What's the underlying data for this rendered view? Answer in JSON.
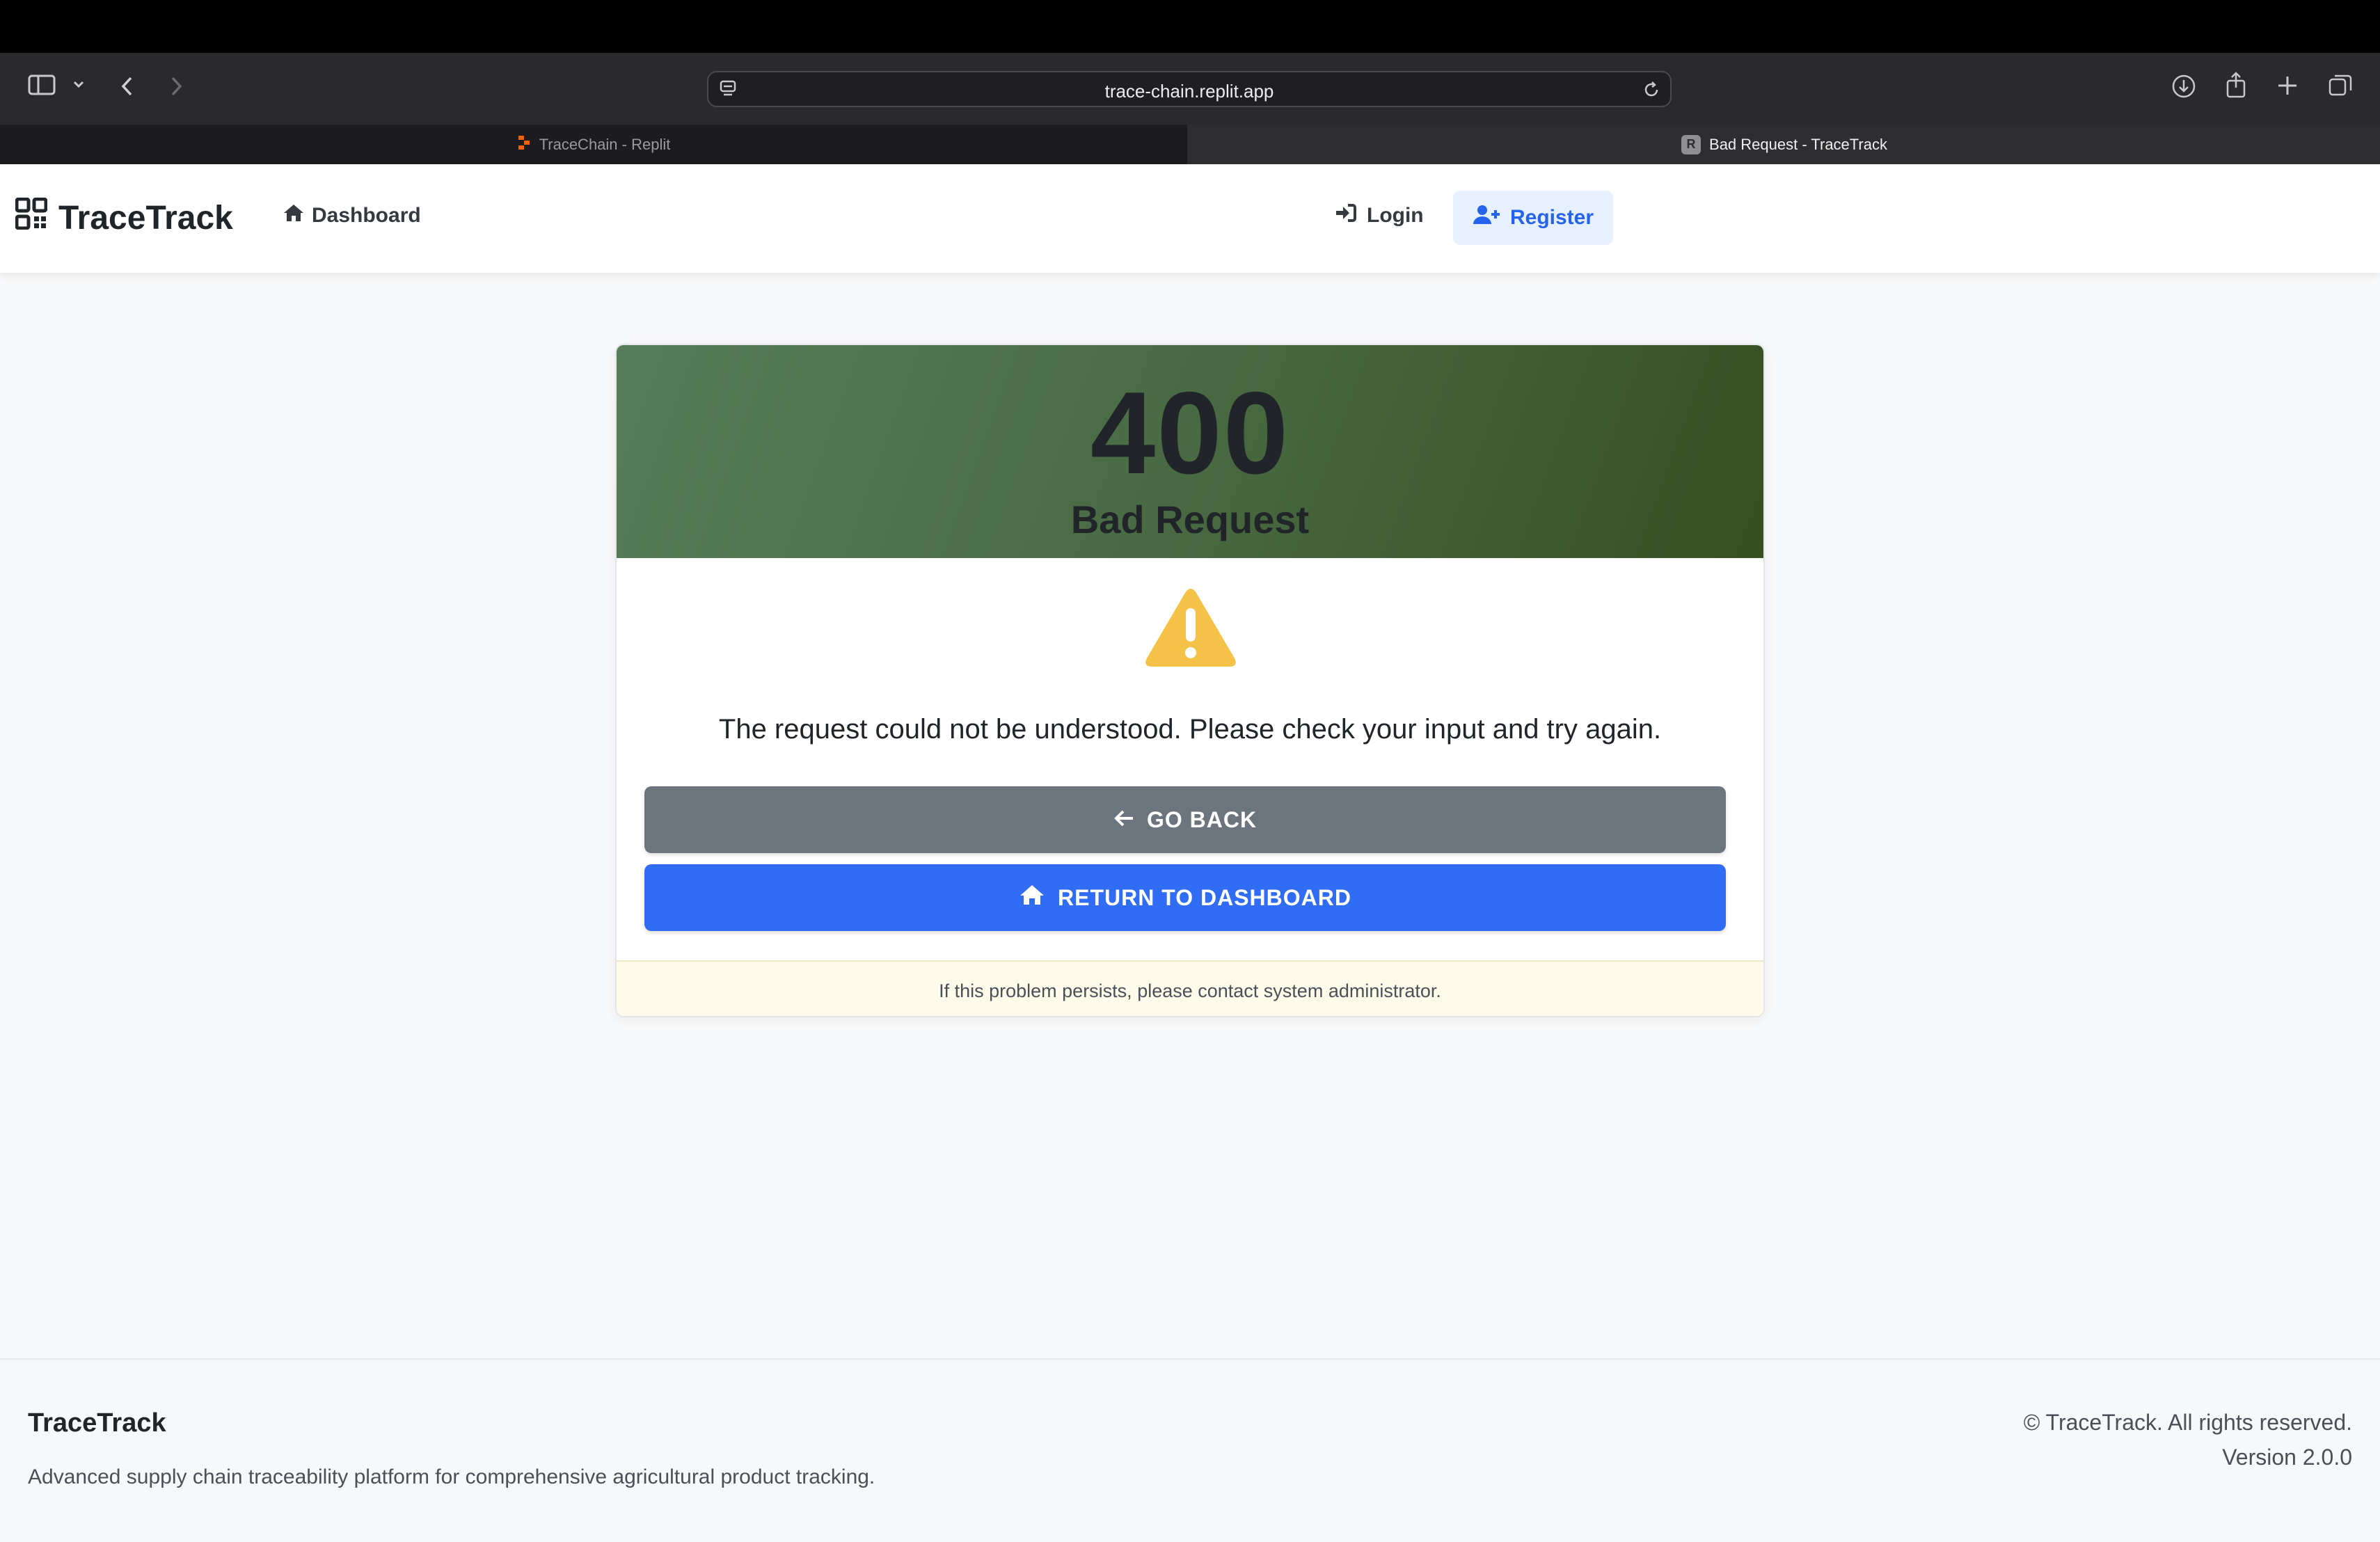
{
  "browser": {
    "url": "trace-chain.replit.app",
    "tabs": [
      {
        "label": "TraceChain - Replit"
      },
      {
        "label": "Bad Request - TraceTrack",
        "favicon_letter": "R"
      }
    ]
  },
  "nav": {
    "brand": "TraceTrack",
    "dashboard": "Dashboard",
    "login": "Login",
    "register": "Register"
  },
  "error": {
    "code": "400",
    "title": "Bad Request",
    "message": "The request could not be understood. Please check your input and try again.",
    "back_label": "GO BACK",
    "dashboard_label": "RETURN TO DASHBOARD",
    "footer_note": "If this problem persists, please contact system administrator."
  },
  "footer": {
    "brand": "TraceTrack",
    "description": "Advanced supply chain traceability platform for comprehensive agricultural product tracking.",
    "copyright": "© TraceTrack. All rights reserved.",
    "version": "Version 2.0.0"
  },
  "colors": {
    "header_gradient_start": "#567d58",
    "header_gradient_end": "#364f22",
    "warning": "#f4c247",
    "primary": "#316cf4",
    "secondary": "#6c757d"
  }
}
